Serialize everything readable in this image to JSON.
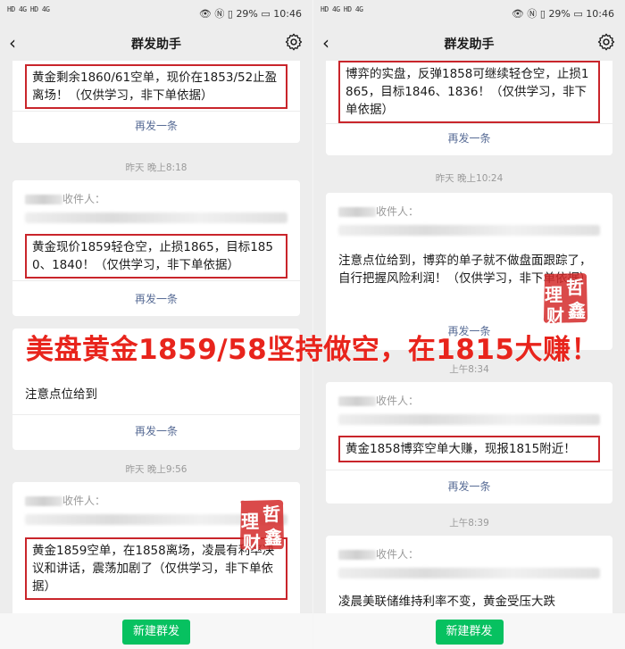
{
  "status_bar": {
    "signal_left": "HD 4G HD 4G",
    "battery": "29%",
    "time": "10:46"
  },
  "nav": {
    "title": "群发助手",
    "back_icon": "back-chevron-icon",
    "settings_icon": "gear-icon"
  },
  "common": {
    "recipients_label": "收件人：",
    "resend_label": "再发一条",
    "new_broadcast_label": "新建群发"
  },
  "left": {
    "card1": {
      "message": "黄金剩余1860/61空单，现价在1853/52止盈离场！（仅供学习，非下单依据）"
    },
    "time1": "昨天 晚上8:18",
    "card2": {
      "message": "黄金现价1859轻仓空，止损1865，目标1850、1840！（仅供学习，非下单依据）"
    },
    "card3": {
      "message": "注意点位给到"
    },
    "time3": "昨天 晚上9:56",
    "card4": {
      "message": "黄金1859空单，在1858离场，凌晨有利率决议和讲话，震荡加剧了（仅供学习，非下单依据）"
    }
  },
  "right": {
    "card1": {
      "message": "博弈的实盘，反弹1858可继续轻仓空，止损1865，目标1846、1836！（仅供学习，非下单依据）"
    },
    "time1": "昨天 晚上10:24",
    "card2": {
      "message": "注意点位给到，博弈的单子就不做盘面跟踪了，自行把握风险利润！（仅供学习，非下单依据）"
    },
    "time2": "上午8:34",
    "card3": {
      "message": "黄金1858博弈空单大赚，现报1815附近！"
    },
    "time3": "上午8:39",
    "card4": {
      "message": "凌晨美联储维持利率不变，黄金受压大跌"
    }
  },
  "overlay": {
    "headline": "美盘黄金1859/58坚持做空，在1815大赚！",
    "seal_chars": [
      "理",
      "哲",
      "财",
      "鑫"
    ],
    "seal_color": "#d42a2a",
    "headline_color": "#e8241c",
    "box_color": "#c9252b",
    "accent_green": "#07c160",
    "link_blue": "#576b95"
  }
}
